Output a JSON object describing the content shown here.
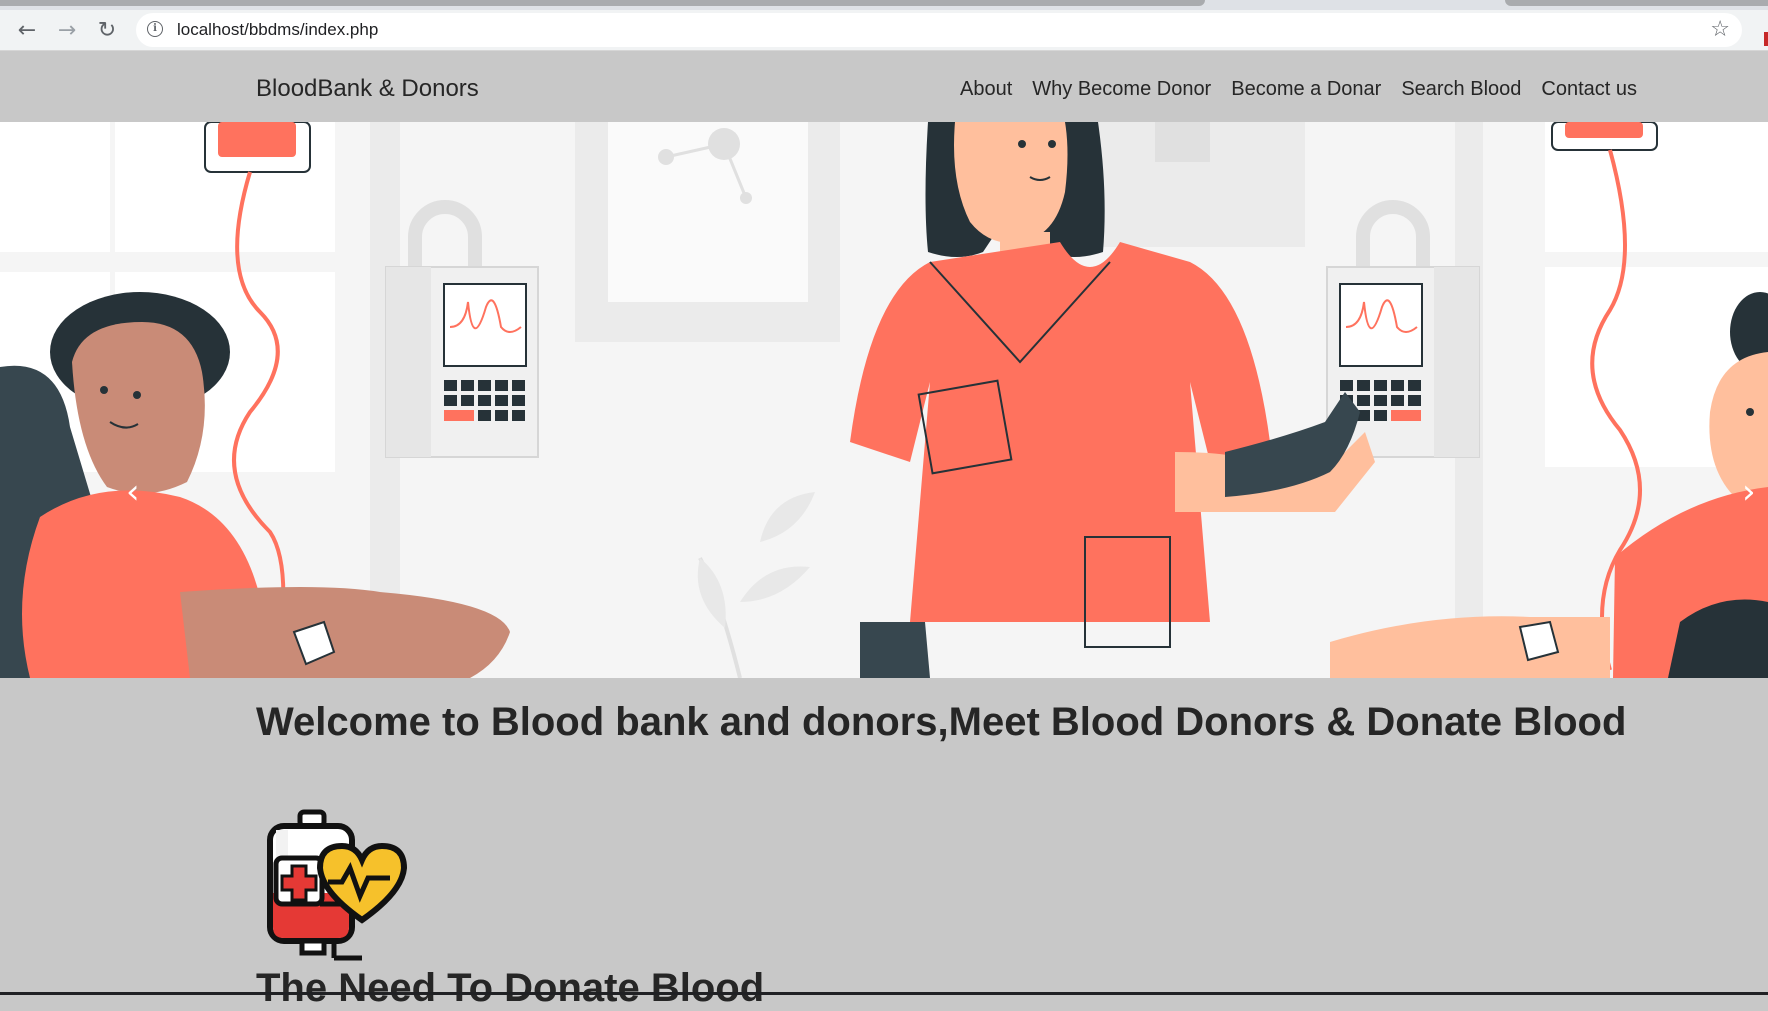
{
  "browser": {
    "url": "localhost/bbdms/index.php",
    "icons": {
      "back": "arrow-left-icon",
      "forward": "arrow-right-icon",
      "reload": "reload-icon",
      "info": "info-icon",
      "bookmark": "star-icon"
    }
  },
  "site": {
    "brand": "BloodBank & Donors",
    "menu": [
      "About",
      "Why Become Donor",
      "Become a Donar",
      "Search Blood",
      "Contact us"
    ]
  },
  "carousel": {
    "slides_count": 2,
    "active_index": 1
  },
  "main": {
    "welcome": "Welcome to Blood bank and donors,Meet Blood Donors & Donate Blood",
    "section_title": "The Need To Donate Blood"
  },
  "colors": {
    "page_bg": "#c8c8c8",
    "accent_coral": "#ff725e",
    "dark_teal": "#263238",
    "heart_yellow": "#f6c12b"
  }
}
